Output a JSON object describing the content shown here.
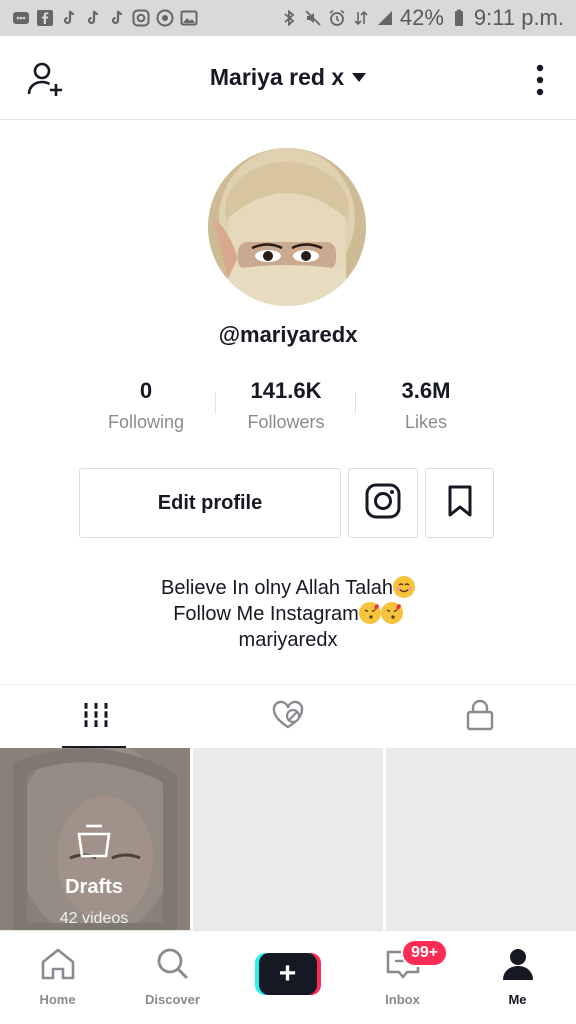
{
  "status_bar": {
    "battery": "42%",
    "time": "9:11 p.m.",
    "left_icons": [
      "message-icon",
      "facebook-icon",
      "tiktok-icon",
      "tiktok-icon",
      "tiktok-icon",
      "instagram-icon",
      "screen-record-icon",
      "image-icon"
    ],
    "right_icons": [
      "bluetooth-icon",
      "mute-icon",
      "alarm-icon",
      "data-icon",
      "signal-icon",
      "battery-icon"
    ]
  },
  "header": {
    "title": "Mariya red x",
    "left_icon": "add-user-icon",
    "right_icon": "more-icon"
  },
  "profile": {
    "username": "@mariyaredx",
    "stats": [
      {
        "value": "0",
        "label": "Following"
      },
      {
        "value": "141.6K",
        "label": "Followers"
      },
      {
        "value": "3.6M",
        "label": "Likes"
      }
    ],
    "edit_label": "Edit profile",
    "bio_line1": "Believe In olny Allah Talah",
    "bio_line2": "Follow Me Instagram",
    "bio_line3": "mariyaredx"
  },
  "tabs": [
    {
      "icon": "grid-icon",
      "active": true
    },
    {
      "icon": "liked-icon",
      "active": false
    },
    {
      "icon": "lock-icon",
      "active": false
    }
  ],
  "grid": {
    "drafts_label": "Drafts",
    "drafts_count": "42 videos"
  },
  "bottom_nav": [
    {
      "label": "Home",
      "icon": "home-icon"
    },
    {
      "label": "Discover",
      "icon": "search-icon"
    },
    {
      "label": "",
      "icon": "plus-icon"
    },
    {
      "label": "Inbox",
      "icon": "inbox-icon",
      "badge": "99+"
    },
    {
      "label": "Me",
      "icon": "me-icon",
      "active": true
    }
  ],
  "colors": {
    "primary_text": "#161823",
    "secondary_text": "#8a8b91",
    "accent_red": "#fe2c55",
    "accent_cyan": "#25f4ee"
  }
}
